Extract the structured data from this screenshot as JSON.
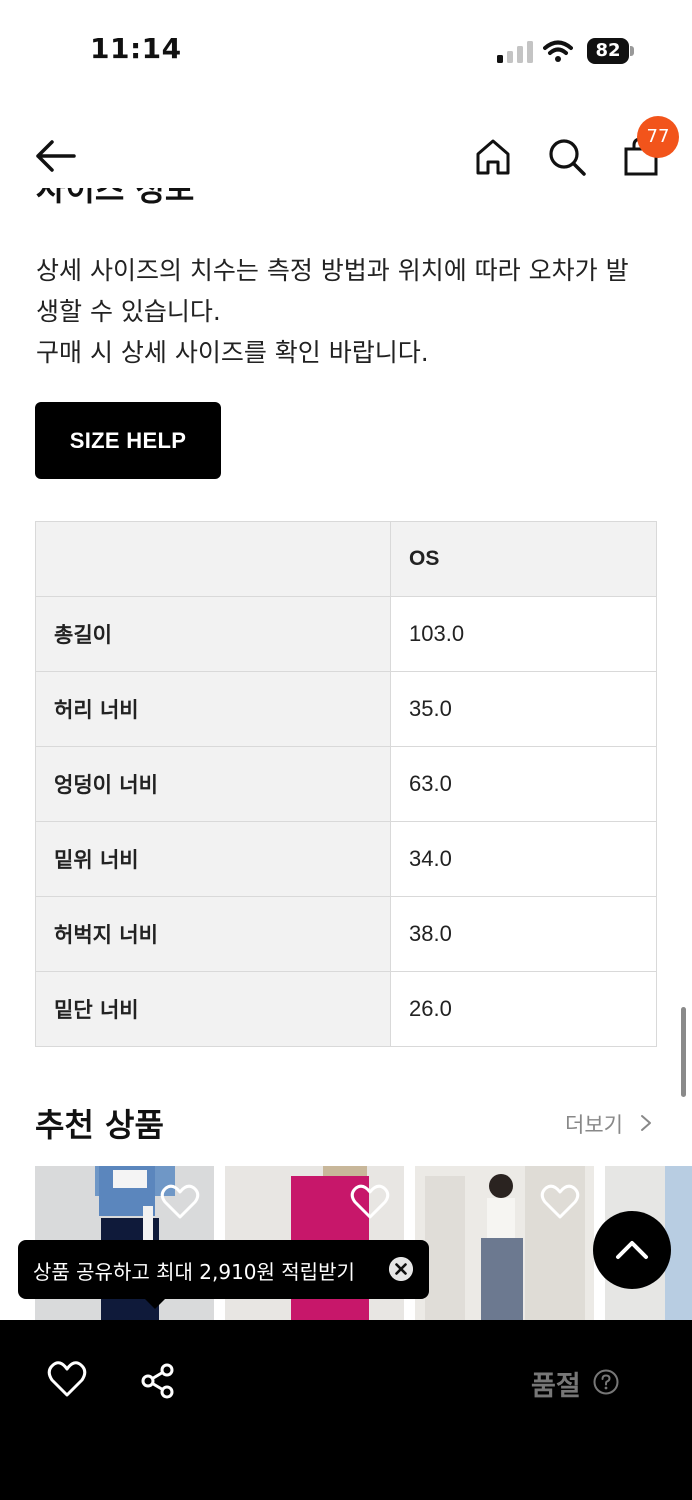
{
  "status_bar": {
    "time": "11:14",
    "battery": "82"
  },
  "nav": {
    "cart_badge": "77"
  },
  "cut_heading": "사이즈 정보",
  "notice": {
    "line1": "상세 사이즈의 치수는 측정 방법과 위치에 따라 오차가 발",
    "line2": "생할 수 있습니다.",
    "line3": "구매 시 상세 사이즈를 확인 바랍니다."
  },
  "size_help_label": "SIZE HELP",
  "size_table": {
    "column_header": "OS",
    "rows": [
      {
        "label": "총길이",
        "value": "103.0"
      },
      {
        "label": "허리 너비",
        "value": "35.0"
      },
      {
        "label": "엉덩이 너비",
        "value": "63.0"
      },
      {
        "label": "밑위 너비",
        "value": "34.0"
      },
      {
        "label": "허벅지 너비",
        "value": "38.0"
      },
      {
        "label": "밑단 너비",
        "value": "26.0"
      }
    ]
  },
  "recommend": {
    "title": "추천 상품",
    "more_label": "더보기"
  },
  "tooltip": {
    "text": "상품 공유하고 최대 2,910원 적립받기"
  },
  "bottom_bar": {
    "soldout_label": "품절"
  },
  "icons": [
    "back-arrow-icon",
    "home-icon",
    "search-icon",
    "shopping-bag-icon",
    "heart-icon",
    "share-icon",
    "close-icon",
    "chevron-up-icon",
    "chevron-right-icon",
    "question-icon"
  ],
  "colors": {
    "badge": "#f2541b",
    "button": "#000000",
    "table_header_bg": "#f2f2f2"
  }
}
